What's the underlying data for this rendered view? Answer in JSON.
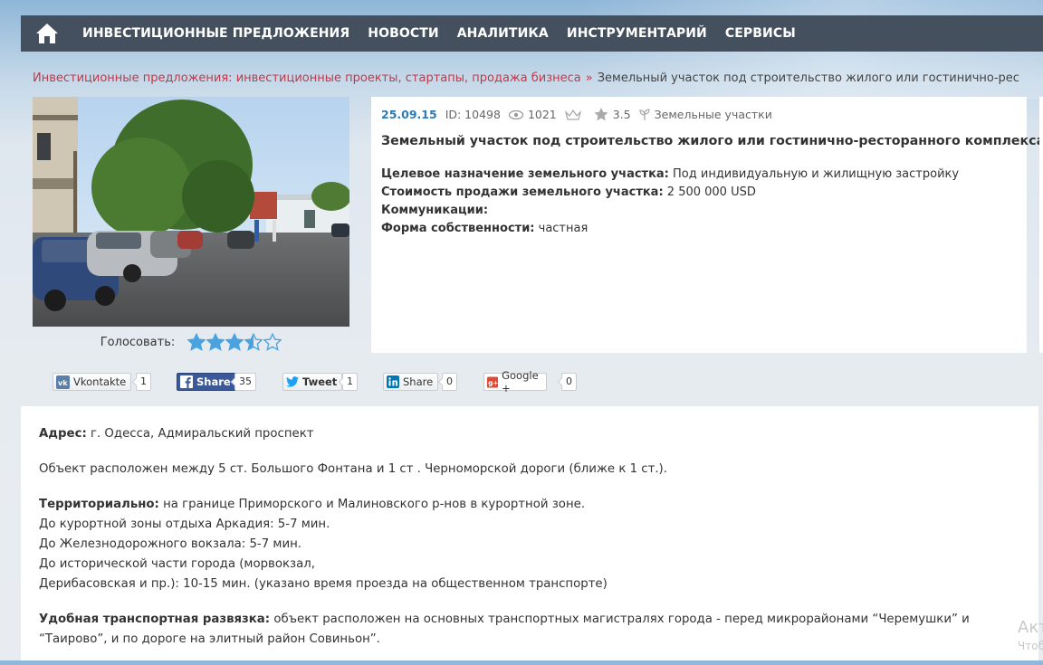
{
  "nav": {
    "home_icon": "home-icon",
    "items": [
      {
        "label": "ИНВЕСТИЦИОННЫЕ ПРЕДЛОЖЕНИЯ"
      },
      {
        "label": "НОВОСТИ"
      },
      {
        "label": "АНАЛИТИКА"
      },
      {
        "label": "ИНСТРУМЕНТАРИЙ"
      },
      {
        "label": "СЕРВИСЫ"
      }
    ]
  },
  "breadcrumb": {
    "link": "Инвестиционные предложения: инвестиционные проекты, стартапы, продажа бизнеса",
    "separator": "»",
    "current": "Земельный участок под строительство жилого или гостинично-ресторанного ..."
  },
  "vote": {
    "label": "Голосовать:",
    "rating": 3.5,
    "max": 5
  },
  "listing": {
    "date": "25.09.15",
    "id": "ID: 10498",
    "views": "1021",
    "rating": "3.5",
    "category": "Земельные участки",
    "title": "Земельный участок под строительство жилого или гостинично-ресторанного комплекса",
    "props": [
      {
        "label": "Целевое назначение земельного участка:",
        "value": " Под индивидуальную и жилищную застройку"
      },
      {
        "label": "Стоимость продажи земельного участка:",
        "value": " 2 500 000 USD"
      },
      {
        "label": "Коммуникации:",
        "value": ""
      },
      {
        "label": "Форма собственности:",
        "value": " частная"
      }
    ]
  },
  "share": {
    "vk": {
      "label": "Vkontakte",
      "count": "1"
    },
    "fb": {
      "label": "Share",
      "count": "35"
    },
    "tw": {
      "label": "Tweet",
      "count": "1"
    },
    "in": {
      "label": "Share",
      "count": "0"
    },
    "gp": {
      "label": "Google +",
      "count": "0"
    }
  },
  "description": {
    "address_label": "Адрес:",
    "address": " г. Одесса, Адмиральский проспект",
    "location": "Объект расположен между 5 ст. Большого Фонтана и 1 ст . Черноморской дороги (ближе к 1 ст.).",
    "territory_label": "Территориально:",
    "territory": " на границе Приморского и Малиновского р-нов в курортной зоне.",
    "lines": [
      "До курортной зоны отдыха Аркадия: 5-7 мин.",
      "До Железнодорожного вокзала: 5-7 мин.",
      "До исторической части города (морвокзал,",
      "Дерибасовская и пр.): 10-15 мин. (указано время проезда на общественном транспорте)"
    ],
    "transport_label": "Удобная транспортная развязка:",
    "transport": " объект расположен на основных транспортных магистралях города - перед микрорайонами “Черемушки” и “Таирово”, и по дороге на элитный район Совиньон”."
  },
  "watermark": {
    "line1": "Акт",
    "line2": "Чтоб"
  }
}
